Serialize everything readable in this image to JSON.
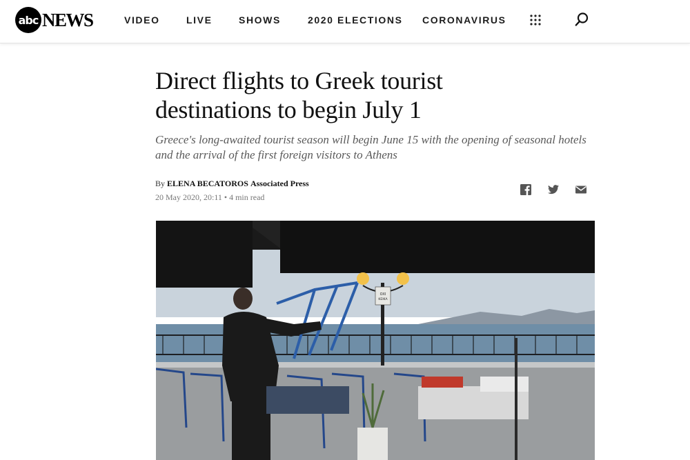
{
  "header": {
    "logo_abc": "abc",
    "logo_news": "NEWS",
    "nav": [
      {
        "label": "VIDEO"
      },
      {
        "label": "LIVE"
      },
      {
        "label": "SHOWS"
      },
      {
        "label": "2020 ELECTIONS"
      },
      {
        "label": "CORONAVIRUS"
      }
    ],
    "menu_icon": "grid-icon",
    "search_icon": "search-icon"
  },
  "article": {
    "headline": "Direct flights to Greek tourist destinations to begin July 1",
    "dek": "Greece's long-awaited tourist season will begin June 15 with the opening of seasonal hotels and the arrival of the first foreign visitors to Athens",
    "byline_prefix": "By",
    "author": "ELENA BECATOROS",
    "organization": "Associated Press",
    "date": "20 May 2020, 20:11",
    "read_time": "• 4 min read",
    "share_icons": [
      "facebook-icon",
      "twitter-icon",
      "email-icon"
    ],
    "photo_sign_text": "ΟΧΙ ΚΕΙΚΑ"
  }
}
